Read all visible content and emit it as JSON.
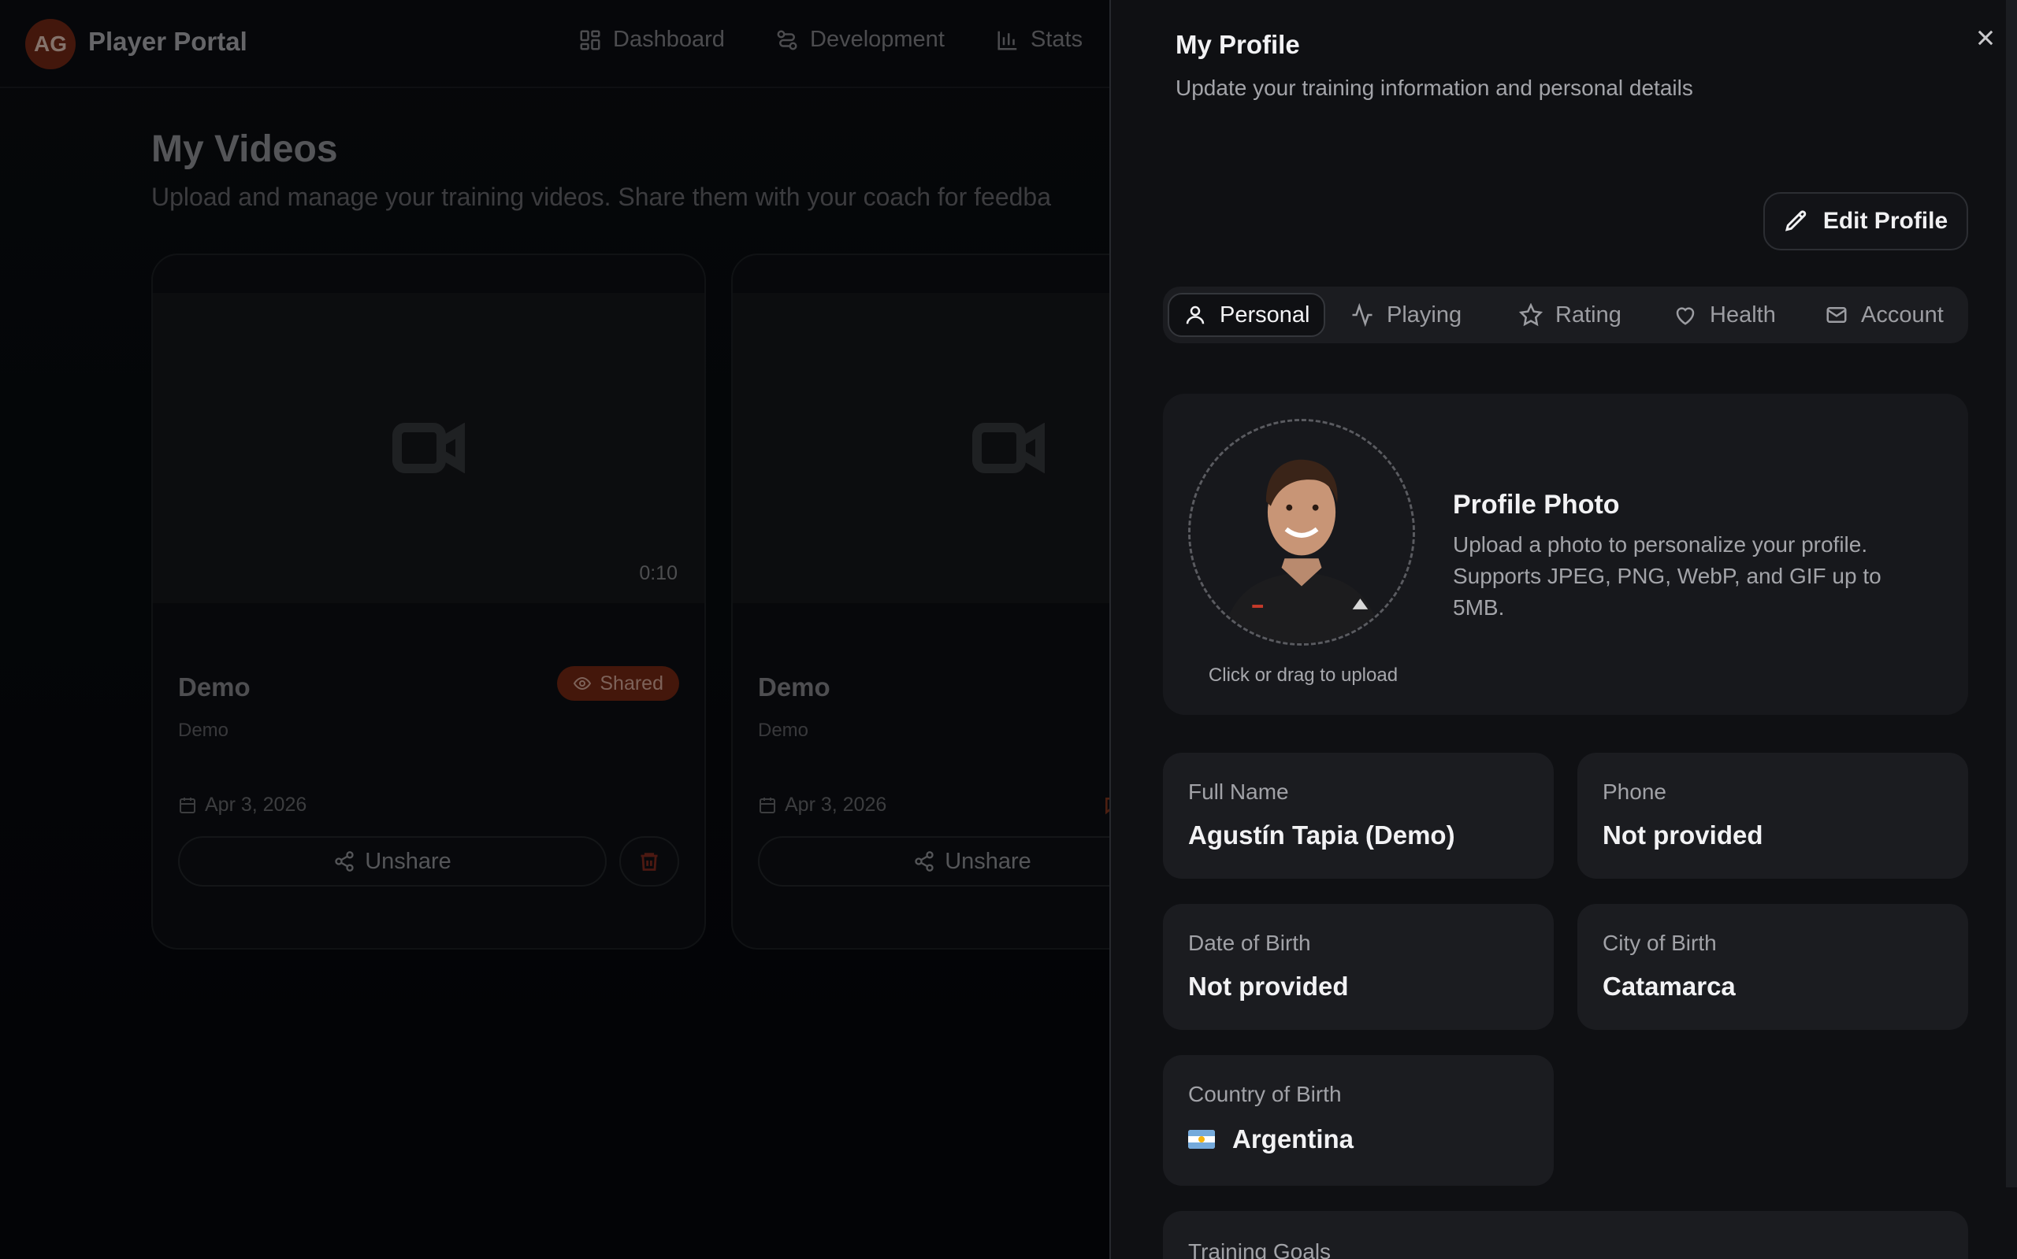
{
  "app": {
    "avatar_initials": "AG",
    "brand": "Player Portal",
    "nav": [
      {
        "label": "Dashboard",
        "icon": "dashboard-icon"
      },
      {
        "label": "Development",
        "icon": "development-icon"
      },
      {
        "label": "Stats",
        "icon": "stats-icon"
      }
    ]
  },
  "videos_page": {
    "title": "My Videos",
    "subtitle": "Upload and manage your training videos. Share them with your coach for feedba",
    "cards": [
      {
        "duration": "0:10",
        "title": "Demo",
        "description": "Demo",
        "badge": "Shared",
        "date": "Apr 3, 2026",
        "action": "Unshare"
      },
      {
        "title": "Demo",
        "description": "Demo",
        "date": "Apr 3, 2026",
        "action": "Unshare"
      }
    ]
  },
  "profile_panel": {
    "title": "My Profile",
    "subtitle": "Update your training information and personal details",
    "edit_label": "Edit Profile",
    "tabs": [
      {
        "label": "Personal",
        "icon": "user-icon",
        "active": true
      },
      {
        "label": "Playing",
        "icon": "activity-icon",
        "active": false
      },
      {
        "label": "Rating",
        "icon": "star-icon",
        "active": false
      },
      {
        "label": "Health",
        "icon": "heart-icon",
        "active": false
      },
      {
        "label": "Account",
        "icon": "mail-icon",
        "active": false
      }
    ],
    "photo": {
      "title": "Profile Photo",
      "description": "Upload a photo to personalize your profile. Supports JPEG, PNG, WebP, and GIF up to 5MB.",
      "hint": "Click or drag to upload"
    },
    "fields": {
      "full_name": {
        "label": "Full Name",
        "value": "Agustín Tapia (Demo)"
      },
      "phone": {
        "label": "Phone",
        "value": "Not provided"
      },
      "dob": {
        "label": "Date of Birth",
        "value": "Not provided"
      },
      "city": {
        "label": "City of Birth",
        "value": "Catamarca"
      },
      "country": {
        "label": "Country of Birth",
        "value": "Argentina",
        "flag_icon": "argentina-flag-icon"
      }
    },
    "training_goals_label": "Training Goals"
  },
  "colors": {
    "accent": "#7c2a14",
    "panel_bg": "#0f1013",
    "field_bg": "#1b1c20"
  }
}
